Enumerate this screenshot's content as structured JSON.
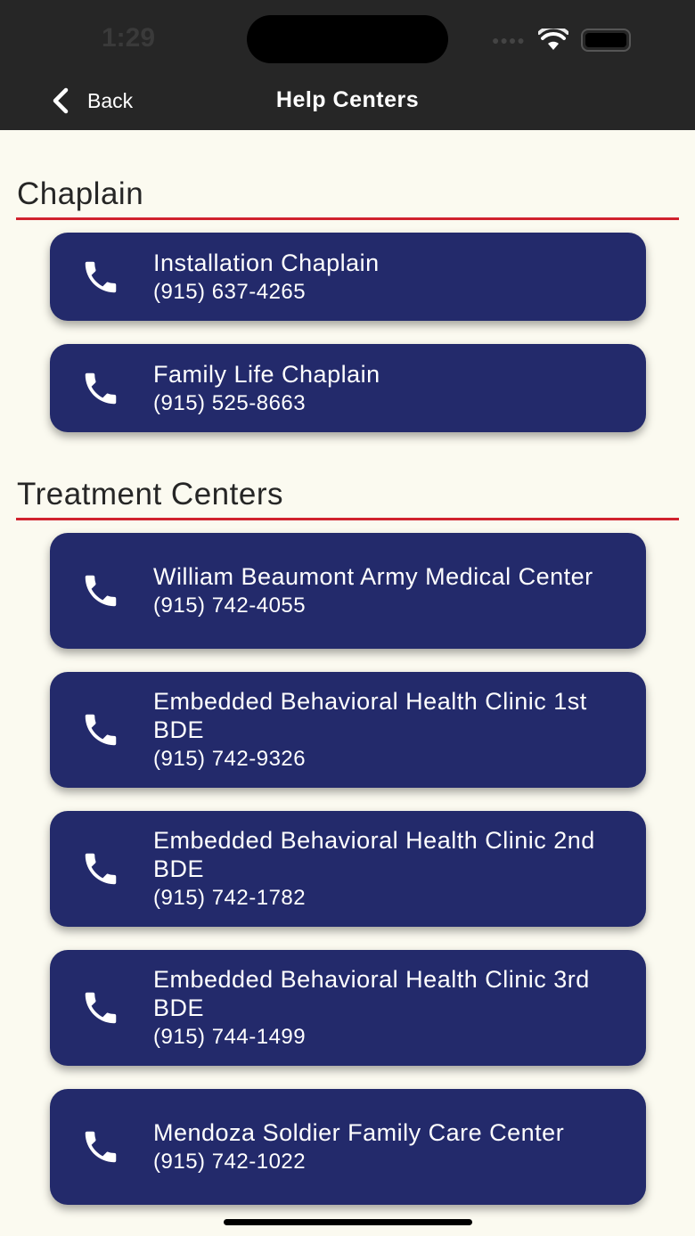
{
  "status_bar": {
    "time": "1:29"
  },
  "nav": {
    "back_label": "Back",
    "title": "Help Centers"
  },
  "colors": {
    "header": "#262626",
    "card": "#232a6b",
    "accent_rule": "#d0222e",
    "background": "#fbfaf0"
  },
  "sections": [
    {
      "title": "Chaplain",
      "items": [
        {
          "name": "Installation Chaplain",
          "phone": "(915) 637-4265"
        },
        {
          "name": "Family Life Chaplain",
          "phone": "(915) 525-8663"
        }
      ]
    },
    {
      "title": "Treatment Centers",
      "items": [
        {
          "name": "William Beaumont Army Medical Center",
          "phone": "(915) 742-4055"
        },
        {
          "name": "Embedded Behavioral Health Clinic 1st BDE",
          "phone": "(915) 742-9326"
        },
        {
          "name": "Embedded Behavioral Health Clinic 2nd BDE",
          "phone": "(915) 742-1782"
        },
        {
          "name": "Embedded Behavioral Health Clinic 3rd BDE",
          "phone": "(915) 744-1499"
        },
        {
          "name": "Mendoza Soldier Family Care Center",
          "phone": "(915) 742-1022"
        }
      ]
    }
  ]
}
